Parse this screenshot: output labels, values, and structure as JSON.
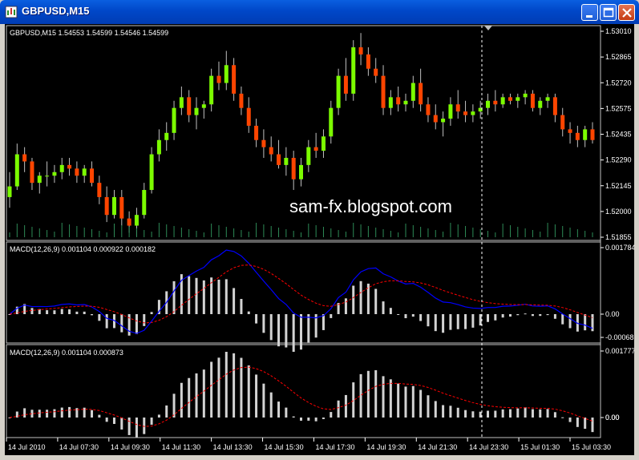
{
  "window": {
    "title": "GBPUSD,M15",
    "minimize_icon": "minimize-icon",
    "maximize_icon": "maximize-icon",
    "close_icon": "close-icon",
    "app_icon": "chart-app-icon"
  },
  "price_panel": {
    "label": "GBPUSD,M15  1.54553 1.54599 1.54546 1.54599",
    "watermark": "sam-fx.blogspot.com",
    "axis": [
      "1.53010",
      "1.52865",
      "1.52720",
      "1.52575",
      "1.52435",
      "1.52290",
      "1.52145",
      "1.52000",
      "1.51855"
    ]
  },
  "macd_panel_1": {
    "label": "MACD(12,26,9) 0.001104 0.000922 0.000182",
    "axis": [
      "0.001784",
      "0.00",
      "-0.00068"
    ]
  },
  "macd_panel_2": {
    "label": "MACD(12,26,9) 0.001104 0.000873",
    "axis": [
      "0.001777",
      "0.00",
      "0.00"
    ]
  },
  "time_axis": [
    "14 Jul 2010",
    "14 Jul 07:30",
    "14 Jul 09:30",
    "14 Jul 11:30",
    "14 Jul 13:30",
    "14 Jul 15:30",
    "14 Jul 17:30",
    "14 Jul 19:30",
    "14 Jul 21:30",
    "14 Jul 23:30",
    "15 Jul 01:30",
    "15 Jul 03:30"
  ],
  "colors": {
    "bull": "#7cfc00",
    "bear": "#ff4500",
    "background": "#000000",
    "grid_text": "#ffffff",
    "macd_line": "#0000ff",
    "signal_line": "#ff0000",
    "histogram": "#d3d3d3"
  },
  "chart_data": {
    "type": "candlestick",
    "symbol": "GBPUSD",
    "timeframe": "M15",
    "ylim": [
      1.51855,
      1.5301
    ],
    "candles_ohlc": [
      [
        1.5208,
        1.5222,
        1.5202,
        1.5214
      ],
      [
        1.5214,
        1.5238,
        1.5212,
        1.5232
      ],
      [
        1.5232,
        1.5236,
        1.5222,
        1.5228
      ],
      [
        1.5228,
        1.523,
        1.5212,
        1.5216
      ],
      [
        1.5216,
        1.5222,
        1.521,
        1.522
      ],
      [
        1.522,
        1.5228,
        1.5214,
        1.522
      ],
      [
        1.522,
        1.5226,
        1.5216,
        1.5222
      ],
      [
        1.5222,
        1.523,
        1.5218,
        1.5226
      ],
      [
        1.5226,
        1.523,
        1.522,
        1.5224
      ],
      [
        1.5224,
        1.5228,
        1.5216,
        1.522
      ],
      [
        1.522,
        1.5226,
        1.5216,
        1.5224
      ],
      [
        1.5224,
        1.5228,
        1.5214,
        1.5216
      ],
      [
        1.5216,
        1.522,
        1.5204,
        1.5208
      ],
      [
        1.5208,
        1.5214,
        1.5194,
        1.5198
      ],
      [
        1.5198,
        1.5212,
        1.5196,
        1.5208
      ],
      [
        1.5208,
        1.5212,
        1.5192,
        1.5196
      ],
      [
        1.5196,
        1.52,
        1.5188,
        1.5192
      ],
      [
        1.5192,
        1.5202,
        1.5186,
        1.5198
      ],
      [
        1.5198,
        1.5216,
        1.5196,
        1.5212
      ],
      [
        1.5212,
        1.5236,
        1.521,
        1.5232
      ],
      [
        1.5232,
        1.5246,
        1.5228,
        1.524
      ],
      [
        1.524,
        1.525,
        1.5234,
        1.5244
      ],
      [
        1.5244,
        1.5262,
        1.524,
        1.5258
      ],
      [
        1.5258,
        1.527,
        1.5254,
        1.5264
      ],
      [
        1.5264,
        1.5268,
        1.525,
        1.5254
      ],
      [
        1.5254,
        1.5264,
        1.5246,
        1.5258
      ],
      [
        1.5258,
        1.5262,
        1.5252,
        1.526
      ],
      [
        1.526,
        1.528,
        1.5256,
        1.5276
      ],
      [
        1.5276,
        1.5284,
        1.5268,
        1.5272
      ],
      [
        1.5272,
        1.529,
        1.5268,
        1.5282
      ],
      [
        1.5282,
        1.5286,
        1.5262,
        1.5266
      ],
      [
        1.5266,
        1.527,
        1.5254,
        1.5258
      ],
      [
        1.5258,
        1.5264,
        1.5244,
        1.5248
      ],
      [
        1.5248,
        1.5252,
        1.5236,
        1.524
      ],
      [
        1.524,
        1.5246,
        1.523,
        1.5236
      ],
      [
        1.5236,
        1.5242,
        1.5228,
        1.5232
      ],
      [
        1.5232,
        1.524,
        1.5224,
        1.5226
      ],
      [
        1.5226,
        1.5236,
        1.522,
        1.523
      ],
      [
        1.523,
        1.5234,
        1.5212,
        1.5218
      ],
      [
        1.5218,
        1.523,
        1.5214,
        1.5226
      ],
      [
        1.5226,
        1.524,
        1.5222,
        1.5236
      ],
      [
        1.5236,
        1.5244,
        1.523,
        1.5234
      ],
      [
        1.5234,
        1.5246,
        1.523,
        1.5242
      ],
      [
        1.5242,
        1.5262,
        1.5238,
        1.5258
      ],
      [
        1.5258,
        1.528,
        1.5254,
        1.5276
      ],
      [
        1.5276,
        1.5286,
        1.5262,
        1.5266
      ],
      [
        1.5266,
        1.5296,
        1.5262,
        1.5292
      ],
      [
        1.5292,
        1.53,
        1.5282,
        1.5288
      ],
      [
        1.5288,
        1.5292,
        1.5276,
        1.528
      ],
      [
        1.528,
        1.5286,
        1.5272,
        1.5276
      ],
      [
        1.5276,
        1.5282,
        1.5254,
        1.5258
      ],
      [
        1.5258,
        1.5268,
        1.5254,
        1.5264
      ],
      [
        1.5264,
        1.527,
        1.5256,
        1.526
      ],
      [
        1.526,
        1.5266,
        1.5256,
        1.5262
      ],
      [
        1.5262,
        1.5276,
        1.5258,
        1.5272
      ],
      [
        1.5272,
        1.528,
        1.5256,
        1.526
      ],
      [
        1.526,
        1.5264,
        1.525,
        1.5254
      ],
      [
        1.5254,
        1.526,
        1.5246,
        1.525
      ],
      [
        1.525,
        1.5256,
        1.5242,
        1.5252
      ],
      [
        1.5252,
        1.5264,
        1.5248,
        1.526
      ],
      [
        1.526,
        1.5268,
        1.5252,
        1.5256
      ],
      [
        1.5256,
        1.5262,
        1.525,
        1.5254
      ],
      [
        1.5254,
        1.526,
        1.525,
        1.5256
      ],
      [
        1.5256,
        1.5262,
        1.5252,
        1.5258
      ],
      [
        1.5258,
        1.5266,
        1.5254,
        1.5262
      ],
      [
        1.5262,
        1.5268,
        1.5256,
        1.526
      ],
      [
        1.526,
        1.5266,
        1.5258,
        1.5264
      ],
      [
        1.5264,
        1.5266,
        1.526,
        1.5262
      ],
      [
        1.5262,
        1.5266,
        1.5258,
        1.5264
      ],
      [
        1.5264,
        1.5268,
        1.526,
        1.5266
      ],
      [
        1.5266,
        1.5268,
        1.5256,
        1.5258
      ],
      [
        1.5258,
        1.5264,
        1.5254,
        1.5262
      ],
      [
        1.5262,
        1.5266,
        1.5258,
        1.5264
      ],
      [
        1.5264,
        1.5266,
        1.525,
        1.5254
      ],
      [
        1.5254,
        1.5258,
        1.5242,
        1.5246
      ],
      [
        1.5246,
        1.525,
        1.5238,
        1.5244
      ],
      [
        1.5244,
        1.5248,
        1.5236,
        1.524
      ],
      [
        1.524,
        1.5248,
        1.5236,
        1.5246
      ],
      [
        1.5246,
        1.525,
        1.5238,
        1.524
      ]
    ],
    "macd1_signal_note": "",
    "time_labels": [
      "14 Jul 2010",
      "14 Jul 07:30",
      "14 Jul 09:30",
      "14 Jul 11:30",
      "14 Jul 13:30",
      "14 Jul 15:30",
      "14 Jul 17:30",
      "14 Jul 19:30",
      "14 Jul 21:30",
      "14 Jul 23:30",
      "15 Jul 01:30",
      "15 Jul 03:30"
    ]
  }
}
